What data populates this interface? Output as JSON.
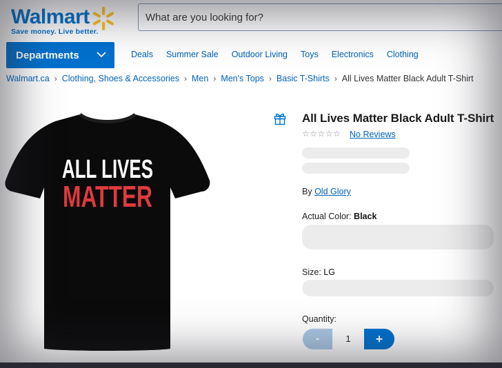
{
  "header": {
    "logo_text": "Walmart",
    "tagline": "Save money. Live better.",
    "search_placeholder": "What are you looking for?"
  },
  "nav": {
    "departments_label": "Departments",
    "links": [
      "Deals",
      "Summer Sale",
      "Outdoor Living",
      "Toys",
      "Electronics",
      "Clothing"
    ]
  },
  "breadcrumb": {
    "items": [
      "Walmart.ca",
      "Clothing, Shoes & Accessories",
      "Men",
      "Men's Tops",
      "Basic T-Shirts"
    ],
    "current": "All Lives Matter Black Adult T-Shirt"
  },
  "product": {
    "image_text_line1": "ALL LIVES",
    "image_text_line2": "MATTER",
    "title": "All Lives Matter Black Adult T-Shirt",
    "stars": "☆☆☆☆☆",
    "reviews": "No Reviews",
    "by_label": "By",
    "brand": "Old Glory",
    "color_label": "Actual Color:",
    "color_value": "Black",
    "size_label": "Size:",
    "size_value": "LG",
    "quantity_label": "Quantity:",
    "quantity_value": "1",
    "minus": "-",
    "plus": "+"
  },
  "colors": {
    "brand_blue": "#0071ce",
    "spark_yellow": "#ffc220",
    "shirt_red": "#e03a3e"
  }
}
